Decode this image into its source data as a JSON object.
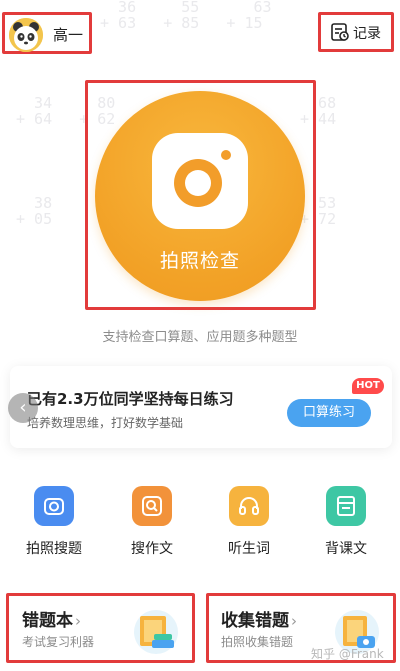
{
  "header": {
    "grade_label": "高一",
    "record_label": "记录"
  },
  "camera": {
    "label": "拍照检查",
    "support_text": "支持检查口算题、应用题多种题型"
  },
  "practice": {
    "title": "已有2.3万位同学坚持每日练习",
    "subtitle": "培养数理思维，打好数学基础",
    "button_label": "口算练习",
    "badge": "HOT",
    "prev_arrow": "‹"
  },
  "features": [
    {
      "label": "拍照搜题",
      "icon": "camera-icon",
      "color": "#4a8cf0"
    },
    {
      "label": "搜作文",
      "icon": "search-icon",
      "color": "#f2923a"
    },
    {
      "label": "听生词",
      "icon": "headphones-icon",
      "color": "#f6b33e"
    },
    {
      "label": "背课文",
      "icon": "book-icon",
      "color": "#3ec7a4"
    }
  ],
  "cards": {
    "mistakes": {
      "title": "错题本",
      "subtitle": "考试复习利器"
    },
    "collect": {
      "title": "收集错题",
      "subtitle": "拍照收集错题"
    }
  },
  "watermark": "知乎 @Frank",
  "colors": {
    "accent": "#f2a126",
    "highlight_border": "#e23b3b",
    "practice_button": "#4aa3f0",
    "hot_badge": "#ff4b4b"
  }
}
